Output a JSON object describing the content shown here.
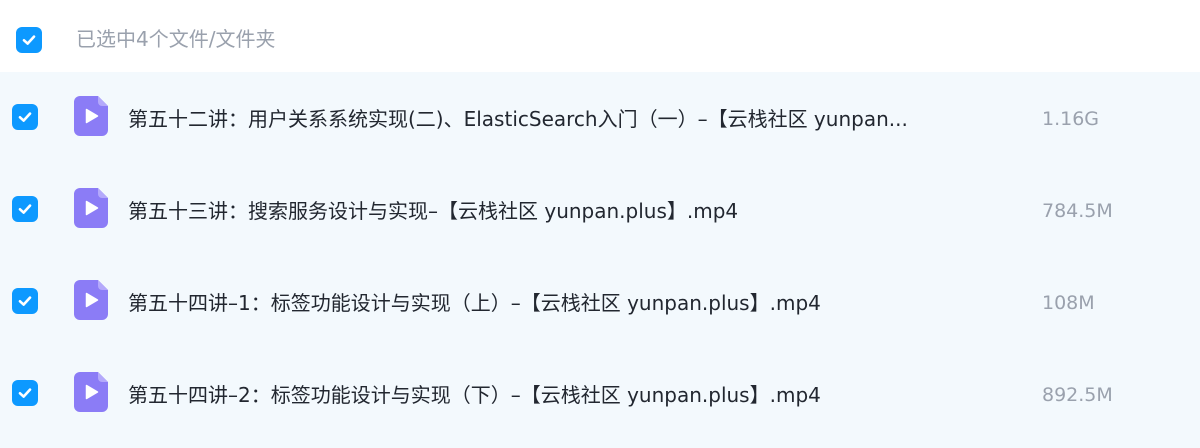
{
  "header": {
    "select_all_checked": true,
    "selection_text": "已选中4个文件/文件夹"
  },
  "colors": {
    "accent": "#0d99ff",
    "list_background": "#f3f9fd",
    "file_icon": "#8b7cf6",
    "text_primary": "#222730",
    "text_secondary": "#9aa1ad"
  },
  "files": [
    {
      "checked": true,
      "icon": "video-file-icon",
      "name": "第五十二讲：用户关系系统实现(二)、ElasticSearch入门（一）–【云栈社区 yunpan...",
      "size": "1.16G"
    },
    {
      "checked": true,
      "icon": "video-file-icon",
      "name": "第五十三讲：搜索服务设计与实现–【云栈社区 yunpan.plus】.mp4",
      "size": "784.5M"
    },
    {
      "checked": true,
      "icon": "video-file-icon",
      "name": "第五十四讲–1：标签功能设计与实现（上）–【云栈社区 yunpan.plus】.mp4",
      "size": "108M"
    },
    {
      "checked": true,
      "icon": "video-file-icon",
      "name": "第五十四讲–2：标签功能设计与实现（下）–【云栈社区 yunpan.plus】.mp4",
      "size": "892.5M"
    }
  ]
}
